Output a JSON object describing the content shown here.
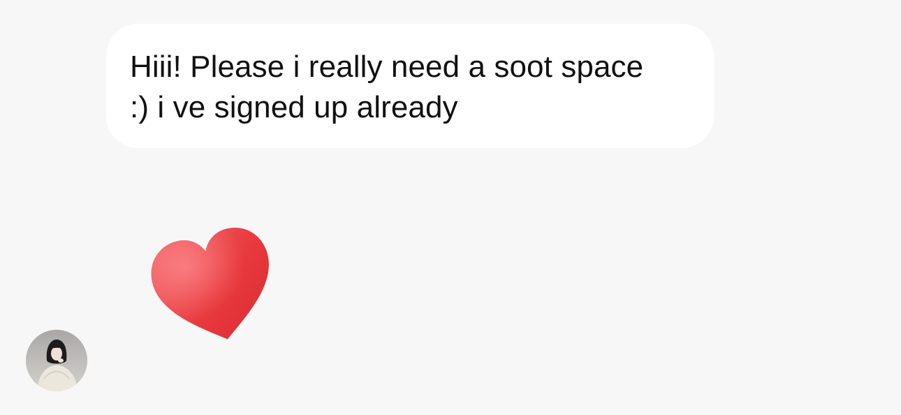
{
  "conversation": {
    "incoming_message": {
      "text": "Hiii! Please i really need a soot space\n:) i ve signed up already"
    },
    "reaction": {
      "icon": "red-heart-icon",
      "color": "#e8333a"
    },
    "sender": {
      "avatar_icon": "profile-photo"
    }
  }
}
